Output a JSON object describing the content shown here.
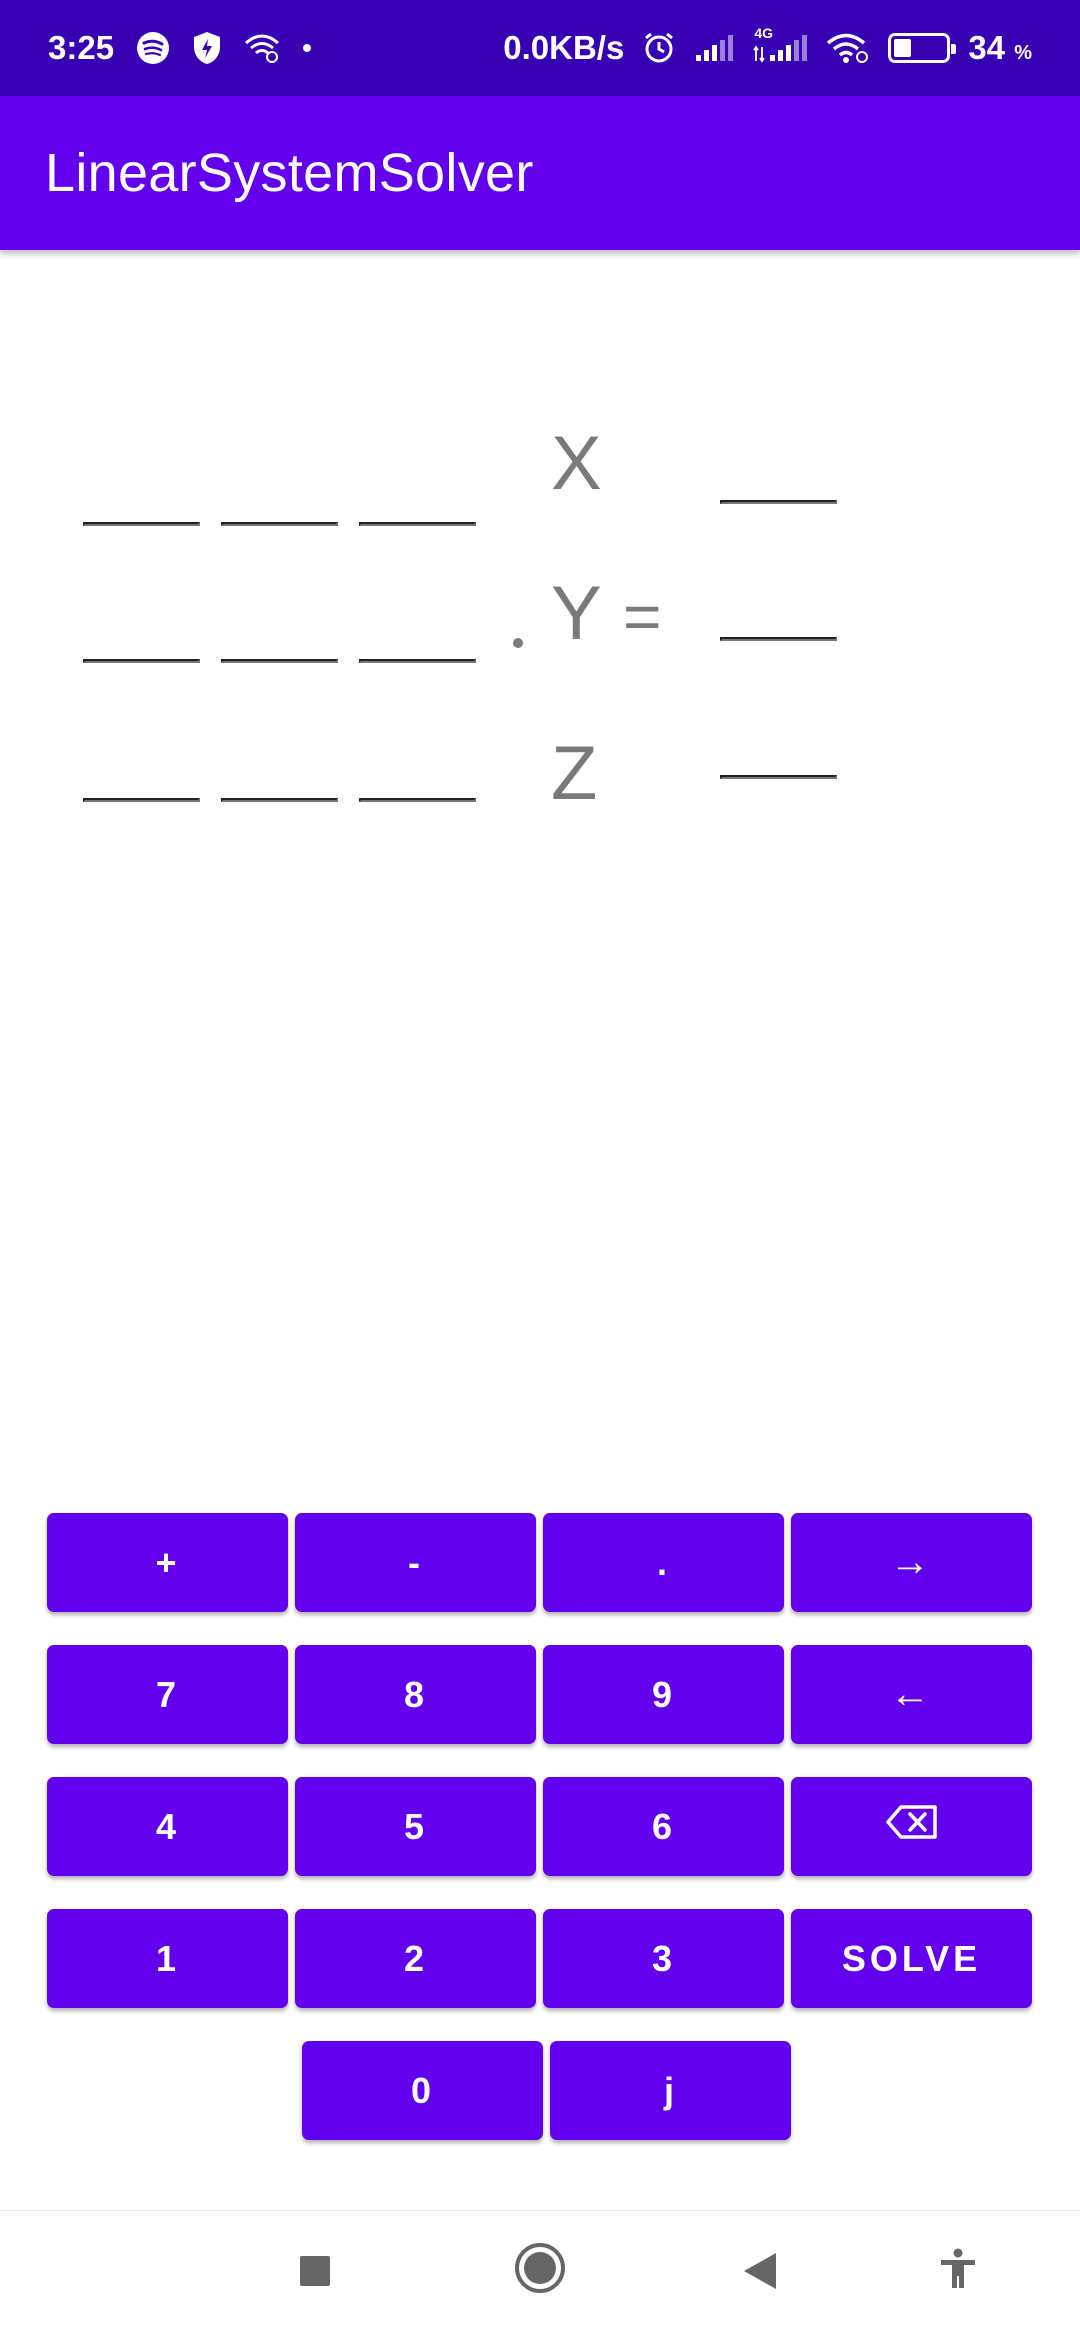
{
  "status_bar": {
    "time": "3:25",
    "network_speed": "0.0KB/s",
    "network_type": "4G",
    "battery_percent": "34",
    "battery_unit": "%",
    "battery_level": 0.34,
    "icons": [
      "spotify-icon",
      "shield-icon",
      "wifi-link-icon",
      "dot-icon",
      "alarm-icon",
      "signal-icon",
      "signal-4g-icon",
      "wifi-icon",
      "battery-icon"
    ]
  },
  "app_bar": {
    "title": "LinearSystemSolver"
  },
  "equation": {
    "matrix": [
      [
        "",
        "",
        ""
      ],
      [
        "",
        "",
        ""
      ],
      [
        "",
        "",
        ""
      ]
    ],
    "variables": [
      "X",
      "Y",
      "Z"
    ],
    "operator": "=",
    "results": [
      "",
      "",
      ""
    ]
  },
  "keypad": {
    "rows": [
      [
        "+",
        "-",
        ".",
        "→"
      ],
      [
        "7",
        "8",
        "9",
        "←"
      ],
      [
        "4",
        "5",
        "6",
        "backspace"
      ],
      [
        "1",
        "2",
        "3",
        "SOLVE"
      ],
      [
        "0",
        "j"
      ]
    ]
  },
  "nav_bar": {
    "buttons": [
      "recents-icon",
      "home-icon",
      "back-icon",
      "accessibility-icon"
    ]
  },
  "colors": {
    "primary": "#6200ee",
    "primary_dark": "#3700b3",
    "text_gray": "#7a7a7a"
  }
}
